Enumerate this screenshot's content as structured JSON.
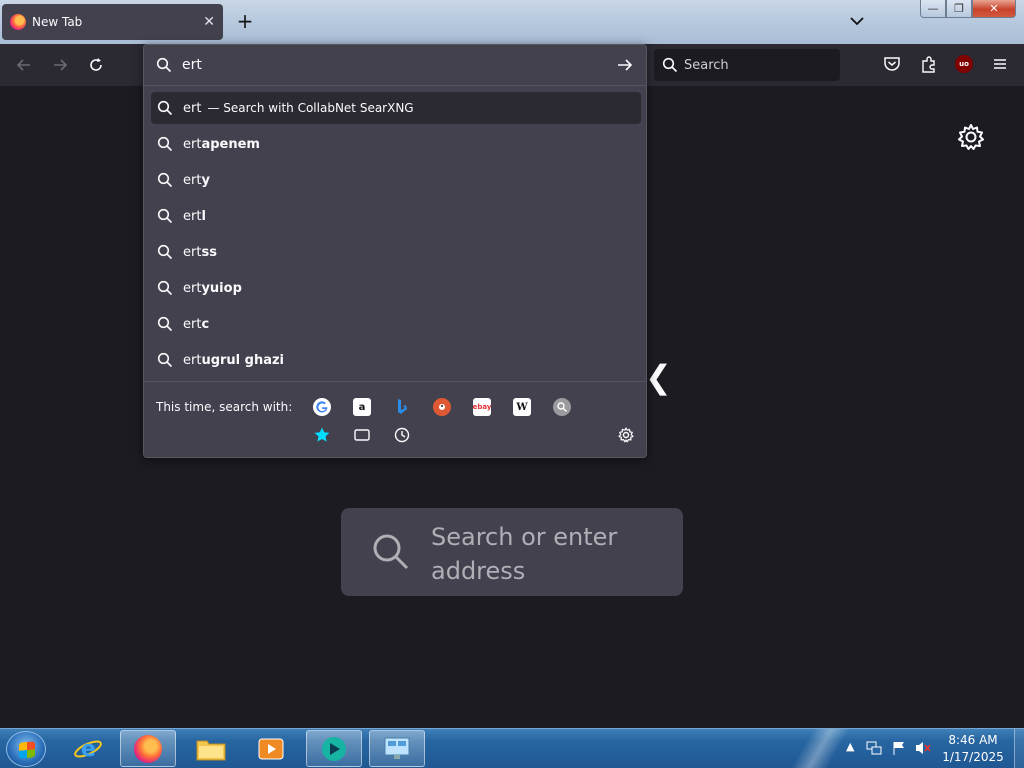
{
  "tab": {
    "title": "New Tab",
    "close_glyph": "✕"
  },
  "tabstrip": {
    "newtab_glyph": "+"
  },
  "window": {
    "min_glyph": "—",
    "max_glyph": "❐",
    "close_glyph": "✕"
  },
  "navbar": {
    "search_placeholder": "Search",
    "ublock_label": "uo"
  },
  "urlbar": {
    "typed": "ert",
    "first_row": {
      "text": "ert",
      "action": "— Search with CollabNet SearXNG"
    },
    "suggestions": [
      {
        "typed": "ert",
        "completion": "apenem"
      },
      {
        "typed": "ert",
        "completion": "y"
      },
      {
        "typed": "ert",
        "completion": "l"
      },
      {
        "typed": "ert",
        "completion": "ss"
      },
      {
        "typed": "ert",
        "completion": "yuiop"
      },
      {
        "typed": "ert",
        "completion": "c"
      },
      {
        "typed": "ert",
        "completion": "ugrul ghazi"
      }
    ],
    "oneoff_label": "This time, search with:",
    "engines": [
      "google-icon",
      "amazon-icon",
      "bing-icon",
      "duckduckgo-icon",
      "ebay-icon",
      "wikipedia-icon",
      "searxng-icon"
    ],
    "engine_glyphs": {
      "amazon": "a",
      "wikipedia": "W",
      "ebay": "ebay"
    },
    "modes": [
      "bookmarks-icon",
      "tabs-icon",
      "history-icon"
    ]
  },
  "page": {
    "search_placeholder": "Search or enter address",
    "logo_glyph": "❮"
  },
  "taskbar": {
    "apps": [
      "internet-explorer-icon",
      "firefox-icon",
      "file-explorer-icon",
      "media-player-icon",
      "app-icon",
      "remote-desktop-icon"
    ],
    "clock_time": "8:46 AM",
    "clock_date": "1/17/2025",
    "tray_arrow": "▲"
  },
  "colors": {
    "page_bg": "#1c1b22",
    "toolbar": "#2b2a33",
    "popup": "#42414d",
    "accent_blue": "#00ddff"
  }
}
